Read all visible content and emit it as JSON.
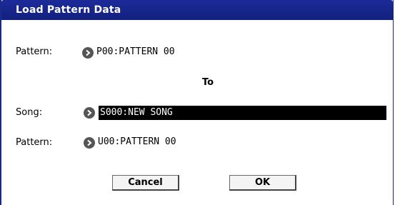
{
  "dialog": {
    "title": "Load Pattern Data"
  },
  "source": {
    "label": "Pattern:",
    "value": "P00:PATTERN 00"
  },
  "separator": "To",
  "song": {
    "label": "Song:",
    "value": "S000:NEW SONG"
  },
  "dest_pattern": {
    "label": "Pattern:",
    "value": "U00:PATTERN 00"
  },
  "buttons": {
    "cancel": "Cancel",
    "ok": "OK"
  },
  "colors": {
    "titlebar": "#1c2b9a",
    "selection": "#000000"
  }
}
